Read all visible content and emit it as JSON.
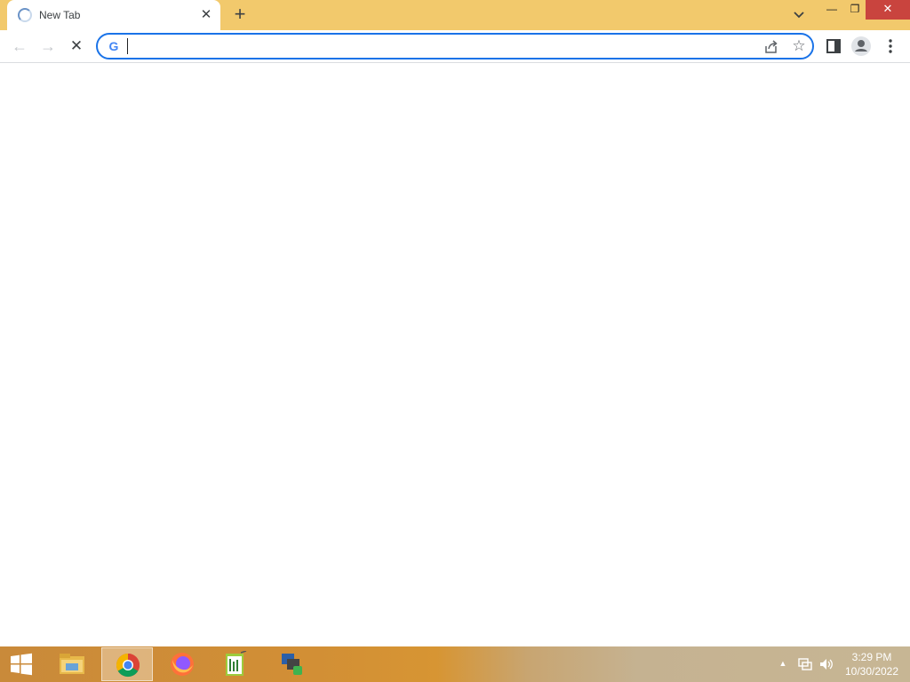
{
  "browser": {
    "tab": {
      "title": "New Tab",
      "close_glyph": "✕",
      "status_icon": "loading-spinner-icon"
    },
    "new_tab_glyph": "+",
    "window_controls": {
      "minimize_glyph": "—",
      "maximize_glyph": "❐",
      "close_glyph": "✕"
    },
    "toolbar": {
      "back_glyph": "←",
      "forward_glyph": "→",
      "stop_glyph": "✕",
      "omnibox_value": "",
      "omnibox_favicon": "G",
      "star_glyph": "☆"
    },
    "colors": {
      "tabstrip": "#f2c96c",
      "accent": "#1a73e8",
      "window_close": "#c9443e"
    }
  },
  "taskbar": {
    "apps": [
      {
        "name": "File Explorer",
        "icon": "folder-icon",
        "active": false
      },
      {
        "name": "Google Chrome",
        "icon": "chrome-icon",
        "active": true
      },
      {
        "name": "Firefox",
        "icon": "firefox-icon",
        "active": false
      },
      {
        "name": "Notepad++",
        "icon": "notepad-plus-icon",
        "active": false
      },
      {
        "name": "App",
        "icon": "app-icon",
        "active": false
      }
    ],
    "tray": {
      "arrow_glyph": "▲"
    },
    "clock": {
      "time": "3:29 PM",
      "date": "10/30/2022"
    }
  }
}
